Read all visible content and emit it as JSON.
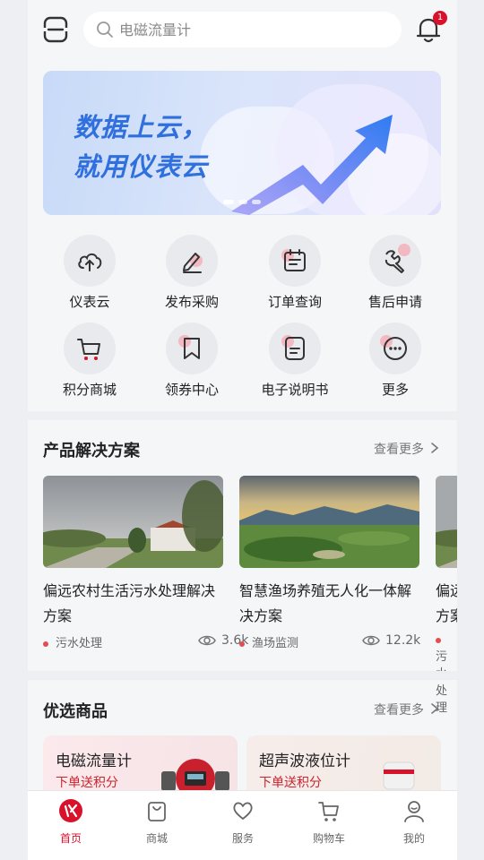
{
  "header": {
    "search_placeholder": "电磁流量计",
    "notification_count": "1"
  },
  "banner": {
    "line1": "数据上云，",
    "line2": "就用仪表云",
    "active_slide": 1,
    "slide_count": 3
  },
  "quick_menu": [
    {
      "label": "仪表云",
      "icon": "cloud-upload-icon"
    },
    {
      "label": "发布采购",
      "icon": "pen-icon"
    },
    {
      "label": "订单查询",
      "icon": "calendar-icon"
    },
    {
      "label": "售后申请",
      "icon": "wrench-icon"
    },
    {
      "label": "积分商城",
      "icon": "cart-icon"
    },
    {
      "label": "领券中心",
      "icon": "bookmark-icon"
    },
    {
      "label": "电子说明书",
      "icon": "manual-icon"
    },
    {
      "label": "更多",
      "icon": "more-icon"
    }
  ],
  "solutions": {
    "title": "产品解决方案",
    "more": "查看更多",
    "cards": [
      {
        "title": "偏远农村生活污水处理解决方案",
        "tag": "污水处理",
        "views": "3.6k"
      },
      {
        "title": "智慧渔场养殖无人化一体解决方案",
        "tag": "渔场监测",
        "views": "12.2k"
      },
      {
        "title": "偏远农村生活污水处理解决方案",
        "tag": "污水处理",
        "views": ""
      }
    ]
  },
  "products": {
    "title": "优选商品",
    "more": "查看更多",
    "items": [
      {
        "name": "电磁流量计",
        "note": "下单送积分"
      },
      {
        "name": "超声波液位计",
        "note": "下单送积分"
      }
    ]
  },
  "tabbar": [
    {
      "label": "首页",
      "icon": "home-logo-icon",
      "active": true
    },
    {
      "label": "商城",
      "icon": "shopping-bag-icon",
      "active": false
    },
    {
      "label": "服务",
      "icon": "heart-icon",
      "active": false
    },
    {
      "label": "购物车",
      "icon": "cart-icon",
      "active": false
    },
    {
      "label": "我的",
      "icon": "user-icon",
      "active": false
    }
  ],
  "colors": {
    "brand_red": "#d8122a",
    "banner_text": "#2f6fde",
    "tag_dot": "#e34d52"
  }
}
